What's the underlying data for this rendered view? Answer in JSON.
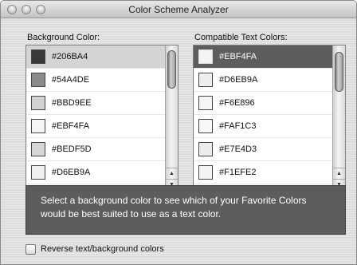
{
  "window": {
    "title": "Color Scheme Analyzer"
  },
  "background_list": {
    "label": "Background Color:",
    "items": [
      {
        "code": "#206BA4",
        "swatch": "#3a3a3a"
      },
      {
        "code": "#54A4DE",
        "swatch": "#8a8a8a"
      },
      {
        "code": "#BBD9EE",
        "swatch": "#d2d2d2"
      },
      {
        "code": "#EBF4FA",
        "swatch": "#f6f6f6"
      },
      {
        "code": "#BEDF5D",
        "swatch": "#d6d6d6"
      },
      {
        "code": "#D6EB9A",
        "swatch": "#f0f0f0"
      }
    ]
  },
  "text_list": {
    "label": "Compatible Text Colors:",
    "items": [
      {
        "code": "#EBF4FA",
        "swatch": "#f3f3f3"
      },
      {
        "code": "#D6EB9A",
        "swatch": "#eeeeee"
      },
      {
        "code": "#F6E896",
        "swatch": "#f5f5f5"
      },
      {
        "code": "#FAF1C3",
        "swatch": "#f8f8f8"
      },
      {
        "code": "#E7E4D3",
        "swatch": "#ececec"
      },
      {
        "code": "#F1EFE2",
        "swatch": "#f4f4f4"
      }
    ]
  },
  "message": "Select a background color to see which of your Favorite Colors would be best suited to use as a text color.",
  "reverse_checkbox": {
    "label": "Reverse text/background colors",
    "checked": false
  }
}
